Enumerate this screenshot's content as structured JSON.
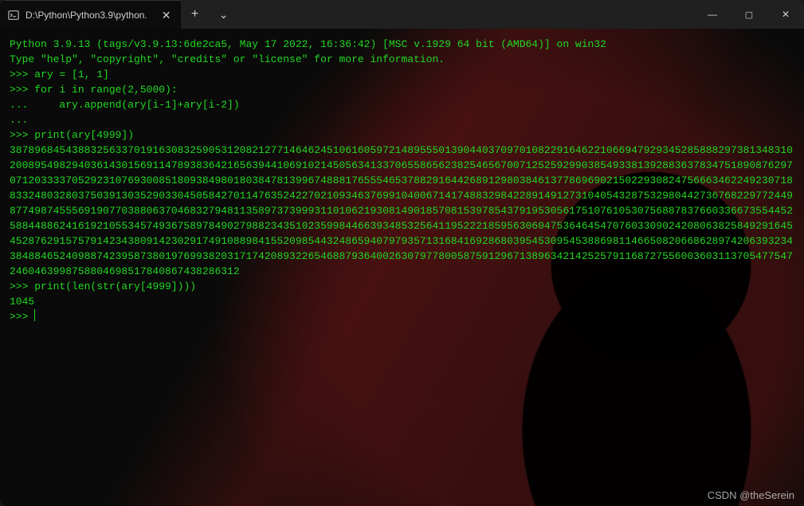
{
  "titlebar": {
    "tab_title": "D:\\Python\\Python3.9\\python.",
    "new_tab_glyph": "+",
    "dropdown_glyph": "⌄",
    "min_glyph": "—",
    "max_glyph": "▢",
    "close_glyph": "✕",
    "tab_close_glyph": "✕"
  },
  "terminal": {
    "banner_line1": "Python 3.9.13 (tags/v3.9.13:6de2ca5, May 17 2022, 16:36:42) [MSC v.1929 64 bit (AMD64)] on win32",
    "banner_line2": "Type \"help\", \"copyright\", \"credits\" or \"license\" for more information.",
    "ps1": ">>> ",
    "ps2": "... ",
    "cmd1": "ary = [1, 1]",
    "cmd2": "for i in range(2,5000):",
    "cmd2_cont": "    ary.append(ary[i-1]+ary[i-2])",
    "cmd3": "print(ary[4999])",
    "big_number": "3878968454388325633701916308325905312082127714646245106160597214895550139044037097010822916462210669479293452858882973813483102008954982940361430156911478938364216563944106910214505634133706558656238254656700712525929903854933813928836378347518908762970712033337052923107693008518093849801803847813996748881765554653788291644268912980384613778696902150229308247566634622492307188332480328037503913035290330450584270114763524227021093463769910400671417488329842289149127310405432875329804427367682297724498774987455569190770388063704683279481135897373999311010621930814901857081539785437919530561751076105307568878376603366735544525884488624161921055345749367589784902798823435102359984466393485325641195222185956306047536464547076033090242080638258492916454528762915757914234380914230291749108898415520985443248659407979357131684169286803954530954538869811466508206686289742063932343848846524098874239587380197699382031717420893226546887936400263079778005875912967138963421425257911687275560036031137054775472460463998758804698517840867438286312",
    "cmd4": "print(len(str(ary[4999])))",
    "out_len": "1045"
  },
  "watermark": "CSDN @theSerein"
}
